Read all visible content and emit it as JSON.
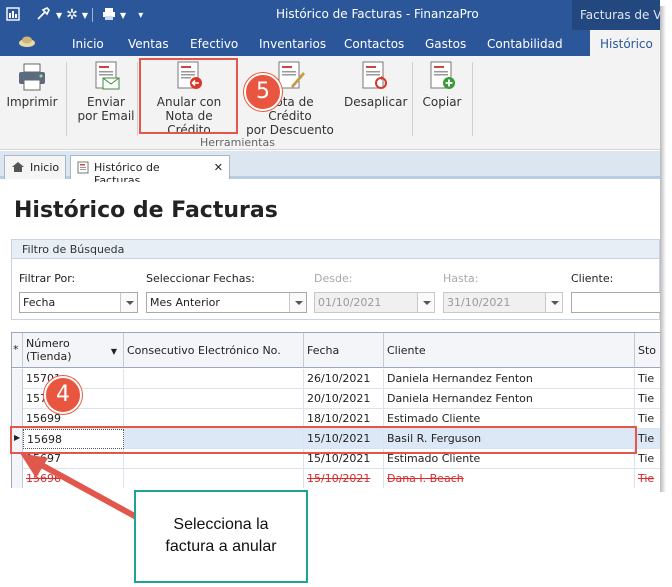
{
  "app": {
    "title": "Histórico de Facturas - FinanzaPro",
    "side_tab": "Facturas de Ve"
  },
  "ribbon_tabs": [
    "Inicio",
    "Ventas",
    "Efectivo",
    "Inventarios",
    "Contactos",
    "Gastos",
    "Contabilidad",
    "Histórico"
  ],
  "ribbon": {
    "print_label": "Imprimir",
    "email_label_1": "Enviar",
    "email_label_2": "por Email",
    "void_label_1": "Anular con",
    "void_label_2": "Nota de Crédito",
    "credit_label_1": "Nota de Crédito",
    "credit_label_2": "por Descuento",
    "unapply_label": "Desaplicar",
    "copy_label": "Copiar",
    "group_label": "Herramientas"
  },
  "doc_tabs": {
    "home": "Inicio",
    "current": "Histórico de Facturas",
    "close_glyph": "✕"
  },
  "page": {
    "title": "Histórico de Facturas"
  },
  "filter": {
    "header": "Filtro de Búsqueda",
    "filter_by_label": "Filtrar Por:",
    "filter_by_value": "Fecha",
    "dates_label": "Seleccionar Fechas:",
    "dates_value": "Mes Anterior",
    "from_label": "Desde:",
    "from_value": "01/10/2021",
    "to_label": "Hasta:",
    "to_value": "31/10/2021",
    "client_label": "Cliente:",
    "client_value": ""
  },
  "grid": {
    "corner": "*",
    "columns": [
      "Número (Tienda)",
      "Consecutivo Electrónico No.",
      "Fecha",
      "Cliente",
      "Sto"
    ],
    "col_number_1": "Número",
    "col_number_2": "(Tienda)",
    "rows": [
      {
        "numero": "15701",
        "fecha": "26/10/2021",
        "cliente": "Daniela Hernandez Fenton",
        "sto": "Tie"
      },
      {
        "numero": "15700",
        "fecha": "20/10/2021",
        "cliente": "Daniela Hernandez Fenton",
        "sto": "Tie"
      },
      {
        "numero": "15699",
        "fecha": "18/10/2021",
        "cliente": "Estimado Cliente",
        "sto": "Tie"
      },
      {
        "numero": "15698",
        "fecha": "15/10/2021",
        "cliente": "Basil R. Ferguson",
        "sto": "Tie"
      },
      {
        "numero": "15697",
        "fecha": "15/10/2021",
        "cliente": "Estimado Cliente",
        "sto": "Tie"
      },
      {
        "numero": "15696",
        "fecha": "15/10/2021",
        "cliente": "Dana I. Beach",
        "sto": "Tie"
      },
      {
        "numero": "15695",
        "fecha": "",
        "cliente": "",
        "sto": ""
      }
    ],
    "selected_index": 3,
    "cancelled_index": 5
  },
  "annotations": {
    "step5": "5",
    "step4": "4",
    "callout_line1": "Selecciona la",
    "callout_line2": "factura a anular",
    "highlight_color": "#e2574c",
    "badge_color": "#e8563f",
    "callout_border": "#1fa493"
  },
  "colors": {
    "title_bar": "#2b579a",
    "selection": "#dce8f6",
    "cancelled_text": "#d92b2b"
  }
}
